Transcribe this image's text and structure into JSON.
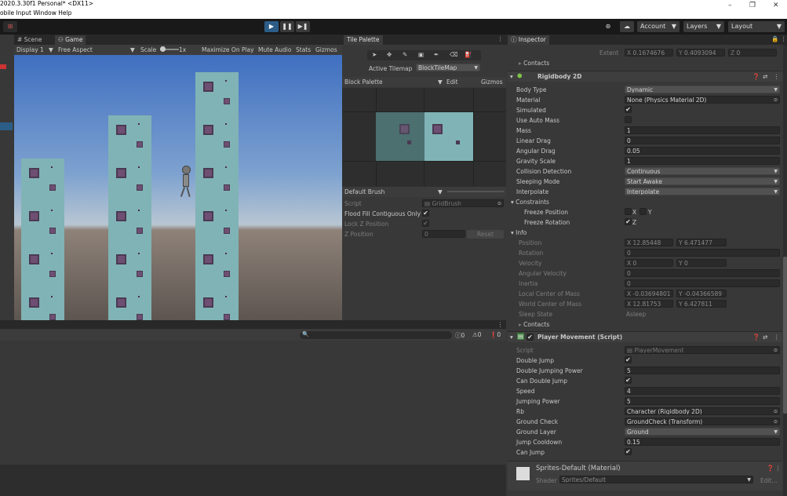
{
  "titlebar": {
    "line1": "2020.3.30f1 Personal* <DX11>",
    "line2": "obile Input   Window   Help",
    "minimize": "–",
    "maximize": "❐",
    "close": "✕"
  },
  "toolbar": {
    "account": "Account",
    "layers": "Layers",
    "layout": "Layout"
  },
  "game": {
    "tab_scene": "Scene",
    "tab_game": "Game",
    "display": "Display 1",
    "aspect": "Free Aspect",
    "scale_label": "Scale",
    "scale_value": "1x",
    "maximize": "Maximize On Play",
    "mute": "Mute Audio",
    "stats": "Stats",
    "gizmos": "Gizmos"
  },
  "tile_palette": {
    "tab": "Tile Palette",
    "active_tilemap_label": "Active Tilemap",
    "active_tilemap": "BlockTileMap",
    "palette": "Block Palette",
    "edit": "Edit",
    "gizmos": "Gizmos",
    "brush": "Default Brush",
    "script_label": "Script",
    "script_value": "GridBrush",
    "flood_fill": "Flood Fill Contiguous Only",
    "lock_z": "Lock Z Position",
    "z_position": "Z Position",
    "z_value": "0",
    "reset": "Reset"
  },
  "console": {
    "count_errors": "0",
    "count_warnings": "0",
    "count_info": "0"
  },
  "inspector": {
    "tab": "Inspector",
    "extent_label": "Extent",
    "extent_x": "0.1674676",
    "extent_y": "0.4093094",
    "extent_z": "0",
    "contacts_top": "Contacts",
    "rigidbody": {
      "title": "Rigidbody 2D",
      "rows": [
        {
          "label": "Body Type",
          "value": "Dynamic",
          "kind": "dd"
        },
        {
          "label": "Material",
          "value": "None (Physics Material 2D)",
          "kind": "obj"
        },
        {
          "label": "Simulated",
          "value": "✔",
          "kind": "chk"
        },
        {
          "label": "Use Auto Mass",
          "value": "",
          "kind": "chk"
        },
        {
          "label": "Mass",
          "value": "1",
          "kind": "txt"
        },
        {
          "label": "Linear Drag",
          "value": "0",
          "kind": "txt"
        },
        {
          "label": "Angular Drag",
          "value": "0.05",
          "kind": "txt"
        },
        {
          "label": "Gravity Scale",
          "value": "1",
          "kind": "txt"
        },
        {
          "label": "Collision Detection",
          "value": "Continuous",
          "kind": "dd"
        },
        {
          "label": "Sleeping Mode",
          "value": "Start Awake",
          "kind": "dd"
        },
        {
          "label": "Interpolate",
          "value": "Interpolate",
          "kind": "dd"
        }
      ],
      "constraints": "Constraints",
      "freeze_pos": "Freeze Position",
      "freeze_rot": "Freeze Rotation",
      "x": "X",
      "y": "Y",
      "z": "Z",
      "info": "Info",
      "position": "Position",
      "pos_x": "12.85448",
      "pos_y": "6.471477",
      "rotation": "Rotation",
      "rotation_val": "0",
      "velocity": "Velocity",
      "vel_x": "0",
      "vel_y": "0",
      "angular_velocity": "Angular Velocity",
      "ang_vel_val": "0",
      "inertia": "Inertia",
      "inertia_val": "0",
      "local_com": "Local Center of Mass",
      "lcom_x": "-0.03694801",
      "lcom_y": "-0.04366589",
      "world_com": "World Center of Mass",
      "wcom_x": "12.81753",
      "wcom_y": "6.427811",
      "sleep_state": "Sleep State",
      "sleep_val": "Asleep",
      "contacts": "Contacts"
    },
    "player": {
      "title": "Player Movement (Script)",
      "rows": [
        {
          "label": "Script",
          "value": "PlayerMovement",
          "kind": "script"
        },
        {
          "label": "Double Jump",
          "value": "✔",
          "kind": "chk"
        },
        {
          "label": "Double Jumping Power",
          "value": "5",
          "kind": "txt"
        },
        {
          "label": "Can Double Jump",
          "value": "✔",
          "kind": "chk"
        },
        {
          "label": "Speed",
          "value": "4",
          "kind": "txt"
        },
        {
          "label": "Jumping Power",
          "value": "5",
          "kind": "txt"
        },
        {
          "label": "Rb",
          "value": "Character (Rigidbody 2D)",
          "kind": "obj"
        },
        {
          "label": "Ground Check",
          "value": "GroundCheck (Transform)",
          "kind": "obj"
        },
        {
          "label": "Ground Layer",
          "value": "Ground",
          "kind": "dd"
        },
        {
          "label": "Jump Cooldown",
          "value": "0.15",
          "kind": "txt"
        },
        {
          "label": "Can Jump",
          "value": "✔",
          "kind": "chk"
        }
      ]
    },
    "material": {
      "title": "Sprites-Default (Material)",
      "shader_label": "Shader",
      "shader_value": "Sprites/Default",
      "edit": "Edit..."
    }
  }
}
